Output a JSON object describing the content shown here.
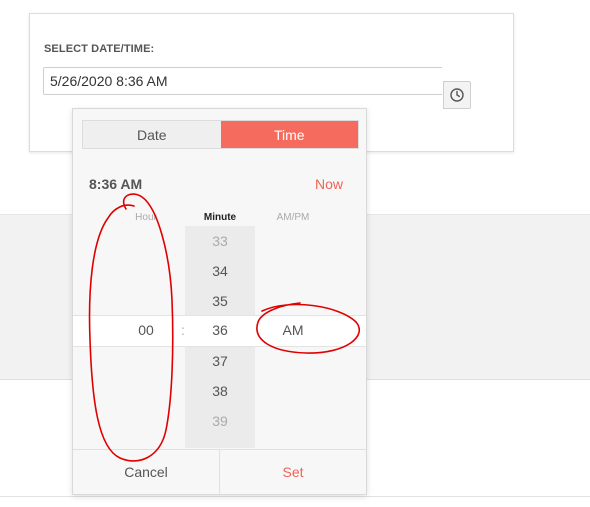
{
  "form": {
    "label": "SELECT DATE/TIME:",
    "value": "5/26/2020 8:36 AM",
    "clock_icon": "clock-icon"
  },
  "picker": {
    "tabs": {
      "date": "Date",
      "time": "Time",
      "active": "Time"
    },
    "current_time": "8:36 AM",
    "now_label": "Now",
    "columns": {
      "hour": "Hour",
      "minute": "Minute",
      "ampm": "AM/PM"
    },
    "hour_selected": "00",
    "minutes": [
      "33",
      "34",
      "35",
      "36",
      "37",
      "38",
      "39"
    ],
    "minute_selected": "36",
    "ampm_selected": "AM",
    "cancel_label": "Cancel",
    "set_label": "Set"
  },
  "colors": {
    "accent": "#f56c5e",
    "annotation": "#e00000"
  }
}
